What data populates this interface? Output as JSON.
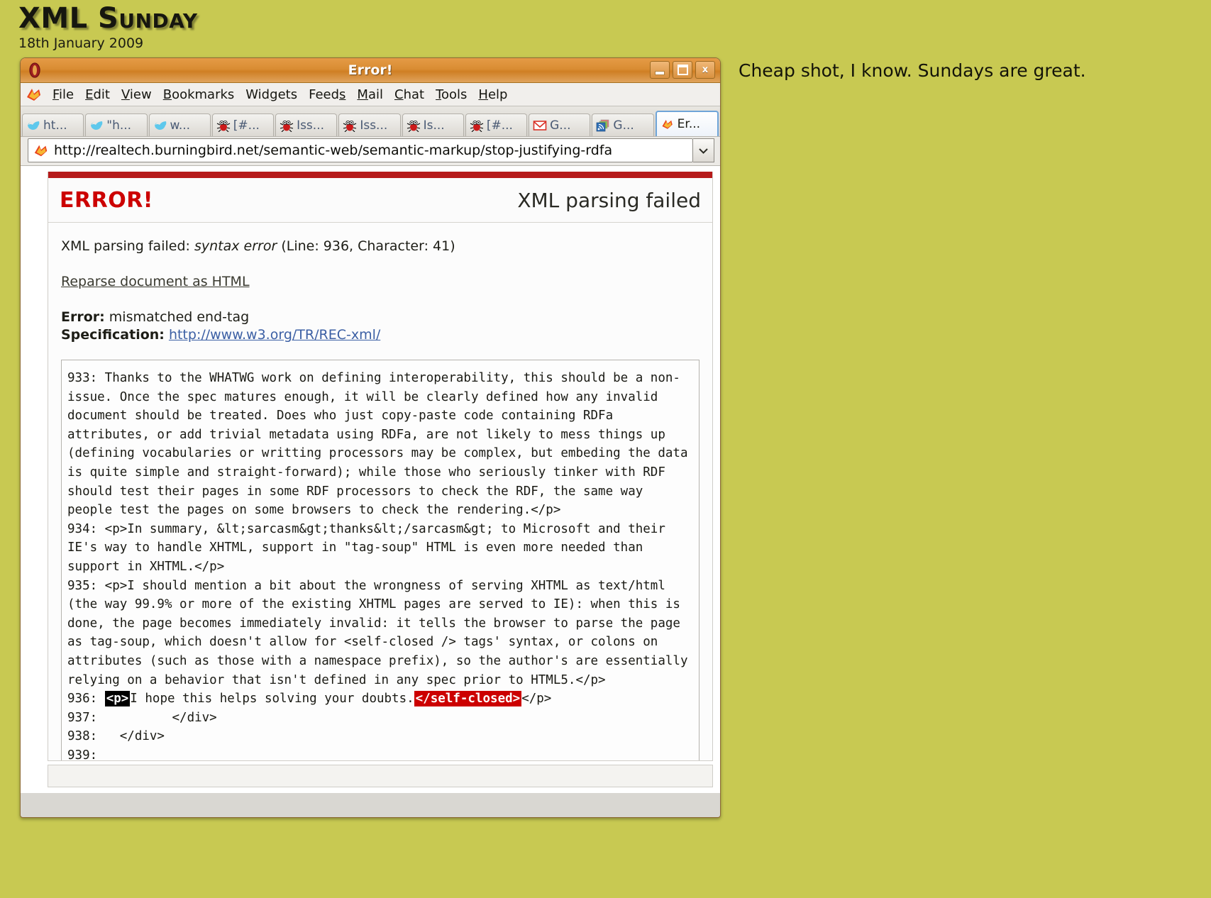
{
  "page": {
    "blog_title": "XML Sunday",
    "blog_date": "18th January 2009",
    "side_caption": "Cheap shot, I know. Sundays are great.",
    "background_color": "#c8c952"
  },
  "window": {
    "title": "Error!",
    "icon_name": "opera-o-icon",
    "buttons": {
      "minimize": "minimize-button",
      "maximize": "maximize-button",
      "close_label": "x"
    }
  },
  "menu": {
    "logo_name": "opera-bird-icon",
    "items": [
      {
        "label": "File",
        "accel": "F"
      },
      {
        "label": "Edit",
        "accel": "E"
      },
      {
        "label": "View",
        "accel": "V"
      },
      {
        "label": "Bookmarks",
        "accel": "B"
      },
      {
        "label": "Widgets",
        "accel": "g"
      },
      {
        "label": "Feeds",
        "accel": "s"
      },
      {
        "label": "Mail",
        "accel": "M"
      },
      {
        "label": "Chat",
        "accel": "C"
      },
      {
        "label": "Tools",
        "accel": "T"
      },
      {
        "label": "Help",
        "accel": "H"
      }
    ]
  },
  "tabs": [
    {
      "label": "ht...",
      "icon": "twitter-icon",
      "active": false
    },
    {
      "label": "\"h...",
      "icon": "twitter-icon",
      "active": false
    },
    {
      "label": "w...",
      "icon": "twitter-icon",
      "active": false
    },
    {
      "label": "[#...",
      "icon": "bug-icon",
      "active": false
    },
    {
      "label": "Iss...",
      "icon": "bug-icon",
      "active": false
    },
    {
      "label": "Iss...",
      "icon": "bug-icon",
      "active": false
    },
    {
      "label": "Is...",
      "icon": "bug-icon",
      "active": false
    },
    {
      "label": "[#...",
      "icon": "bug-icon",
      "active": false
    },
    {
      "label": "G...",
      "icon": "gmail-icon",
      "active": false
    },
    {
      "label": "G...",
      "icon": "rss-reader-icon",
      "active": false
    },
    {
      "label": "Er...",
      "icon": "opera-bird-icon",
      "active": true
    }
  ],
  "address": {
    "icon": "opera-bird-icon",
    "url": "http://realtech.burningbird.net/semantic-web/semantic-markup/stop-justifying-rdfa",
    "dropdown_icon": "chevron-down-icon"
  },
  "error_page": {
    "accent_color": "#cc0000",
    "heading": "ERROR!",
    "subheading": "XML parsing failed",
    "summary_prefix": "XML parsing failed:",
    "summary_em": "syntax error",
    "summary_suffix": "(Line: 936, Character: 41)",
    "reparse_link": "Reparse document as HTML",
    "error_label": "Error:",
    "error_value": "mismatched end-tag",
    "spec_label": "Specification:",
    "spec_url": "http://www.w3.org/TR/REC-xml/",
    "code_lines": [
      "933: Thanks to the WHATWG work on defining interoperability, this should be a non-issue. Once the spec matures enough, it will be clearly defined how any invalid document should be treated. Does who just copy-paste code containing RDFa attributes, or add trivial metadata using RDFa, are not likely to mess things up (defining vocabularies or writting processors may be complex, but embeding the data is quite simple and straight-forward); while those who seriously tinker with RDF should test their pages in some RDF processors to check the RDF, the same way people test the pages on some browsers to check the rendering.</p>",
      "934: <p>In summary, &lt;sarcasm&gt;thanks&lt;/sarcasm&gt; to Microsoft and their IE's way to handle XHTML, support in \"tag-soup\" HTML is even more needed than support in XHTML.</p>",
      "935: <p>I should mention a bit about the wrongness of serving XHTML as text/html (the way 99.9% or more of the existing XHTML pages are served to IE): when this is done, the page becomes immediately invalid: it tells the browser to parse the page as tag-soup, which doesn't allow for <self-closed /> tags' syntax, or colons on attributes (such as those with a namespace prefix), so the author's are essentially relying on a behavior that isn't defined in any spec prior to HTML5.</p>"
    ],
    "highlight_line": {
      "number": "936: ",
      "tag_open": "<p>",
      "text": "I hope this helps solving your doubts.",
      "bad_tag": "</self-closed>",
      "tag_close": "</p>",
      "tag_open_bg": "#000000",
      "bad_tag_bg": "#cc0000"
    },
    "trailing_lines": [
      "937:          </div>",
      "938:   </div>",
      "939: "
    ]
  }
}
